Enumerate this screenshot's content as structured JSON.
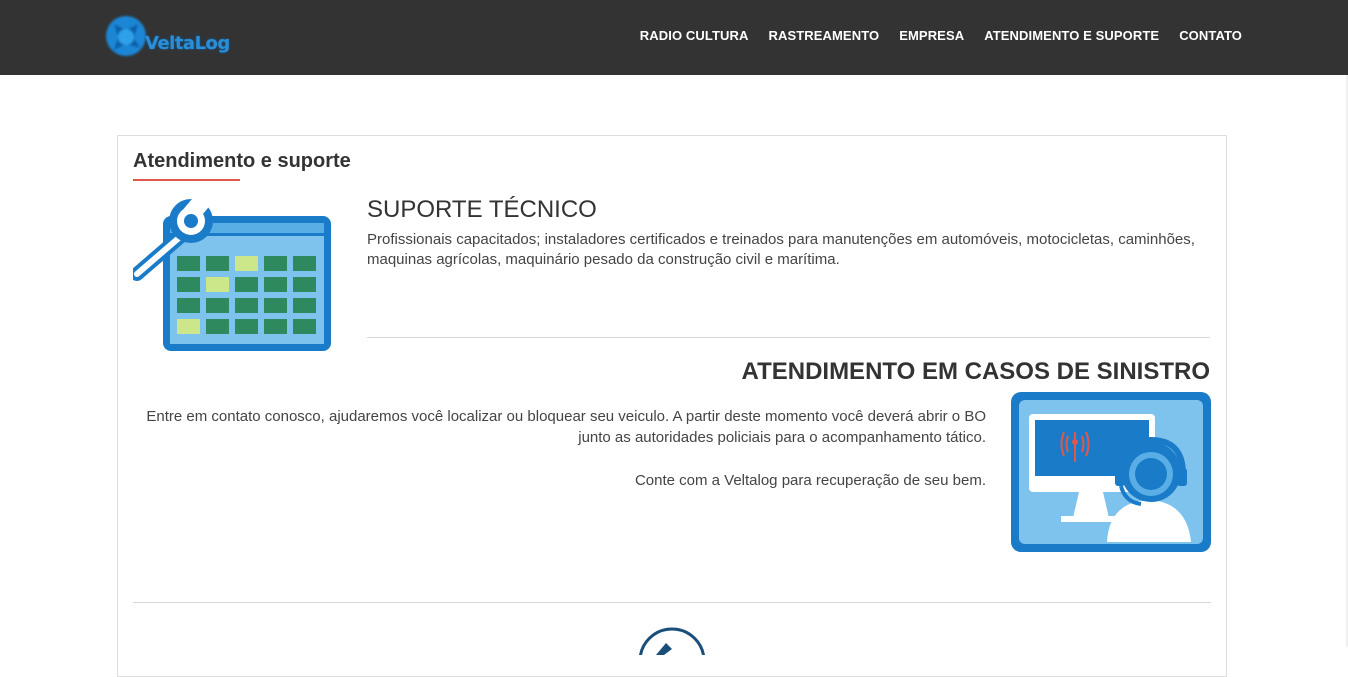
{
  "header": {
    "logo_text": "VeltaLog",
    "nav": [
      {
        "label": "RADIO CULTURA"
      },
      {
        "label": "RASTREAMENTO"
      },
      {
        "label": "EMPRESA"
      },
      {
        "label": "ATENDIMENTO E SUPORTE"
      },
      {
        "label": "CONTATO"
      }
    ]
  },
  "main": {
    "title": "Atendimento e suporte",
    "support": {
      "heading": "SUPORTE TÉCNICO",
      "text": "Profissionais capacitados; instaladores certificados e treinados para manutenções em automóveis, motocicletas, caminhões, maquinas agrícolas, maquinário pesado da construção civil e marítima."
    },
    "sinistro": {
      "heading": "ATENDIMENTO EM CASOS DE SINISTRO",
      "text1": "Entre em contato conosco, ajudaremos você localizar ou bloquear seu veiculo. A partir deste momento você deverá abrir o BO junto as autoridades policiais para o acompanhamento tático.",
      "text2": "Conte com a Veltalog para recuperação de seu bem."
    }
  },
  "icons": {
    "logo": "veltalog-logo-icon",
    "calendar": "calendar-wrench-icon",
    "support": "support-agent-monitor-icon",
    "bottom": "partial-circle-icon"
  },
  "colors": {
    "header_bg": "#333333",
    "accent_red": "#e0584a",
    "brand_blue": "#1a7cc9"
  }
}
